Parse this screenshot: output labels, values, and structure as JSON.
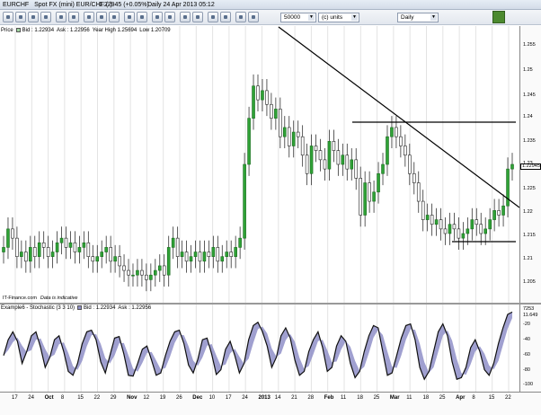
{
  "window": {
    "symbol": "EURCHF",
    "instrument": "Spot FX (mini) EUR/CHF (-)",
    "last_price": "1.22945 (+0.05%)",
    "period_info": "Daily  24 Apr 2013 05:12"
  },
  "toolbar": {
    "quantity_value": "50000",
    "units_value": "(c) units",
    "interval_value": "Daily"
  },
  "price_panel": {
    "legend": {
      "label": "Price",
      "bid": "Bid : 1.22934",
      "ask": "Ask : 1.22956",
      "year_high": "Year High 1.25694",
      "year_low": "Low 1.20709"
    },
    "y_ticks": [
      "1.255",
      "1.25",
      "1.245",
      "1.24",
      "1.235",
      "1.23",
      "1.225",
      "1.22",
      "1.215",
      "1.21",
      "1.205"
    ],
    "current_price_flag": "1.22945",
    "watermark": "IT-Finance.com",
    "watermark_note": "Data is indicative"
  },
  "stochastic_panel": {
    "legend": {
      "label": "Example6 - Stochastic (3 3 10)",
      "bid": "Bid : 1.22934",
      "ask": "Ask : 1.22956"
    },
    "y_ticks": [
      "7253",
      "11.649",
      "-20",
      "-40",
      "-60",
      "-80",
      "-100"
    ]
  },
  "x_axis": {
    "labels": [
      {
        "text": "17",
        "major": false
      },
      {
        "text": "24",
        "major": false
      },
      {
        "text": "Oct",
        "major": true
      },
      {
        "text": "8",
        "major": false
      },
      {
        "text": "15",
        "major": false
      },
      {
        "text": "22",
        "major": false
      },
      {
        "text": "29",
        "major": false
      },
      {
        "text": "Nov",
        "major": true
      },
      {
        "text": "12",
        "major": false
      },
      {
        "text": "19",
        "major": false
      },
      {
        "text": "26",
        "major": false
      },
      {
        "text": "Dec",
        "major": true
      },
      {
        "text": "10",
        "major": false
      },
      {
        "text": "17",
        "major": false
      },
      {
        "text": "24",
        "major": false
      },
      {
        "text": "2013",
        "major": true
      },
      {
        "text": "14",
        "major": false
      },
      {
        "text": "21",
        "major": false
      },
      {
        "text": "28",
        "major": false
      },
      {
        "text": "Feb",
        "major": true
      },
      {
        "text": "11",
        "major": false
      },
      {
        "text": "18",
        "major": false
      },
      {
        "text": "25",
        "major": false
      },
      {
        "text": "Mar",
        "major": true
      },
      {
        "text": "11",
        "major": false
      },
      {
        "text": "18",
        "major": false
      },
      {
        "text": "25",
        "major": false
      },
      {
        "text": "Apr",
        "major": true
      },
      {
        "text": "8",
        "major": false
      },
      {
        "text": "15",
        "major": false
      },
      {
        "text": "22",
        "major": false
      }
    ]
  },
  "colors": {
    "up_candle": "#2fa236",
    "down_candle": "#222222",
    "trendline": "#000000",
    "stoch_fill": "#8f8fc8",
    "stoch_line": "#111111"
  },
  "chart_data": {
    "type": "line",
    "price_range": [
      1.2,
      1.26
    ],
    "stochastic_range": [
      -100,
      0
    ],
    "close": [
      1.212,
      1.216,
      1.214,
      1.21,
      1.211,
      1.209,
      1.212,
      1.21,
      1.213,
      1.212,
      1.21,
      1.211,
      1.213,
      1.214,
      1.212,
      1.213,
      1.211,
      1.212,
      1.213,
      1.21,
      1.209,
      1.21,
      1.211,
      1.212,
      1.209,
      1.21,
      1.208,
      1.207,
      1.206,
      1.206,
      1.207,
      1.206,
      1.205,
      1.206,
      1.207,
      1.208,
      1.206,
      1.212,
      1.214,
      1.21,
      1.211,
      1.209,
      1.21,
      1.211,
      1.209,
      1.211,
      1.21,
      1.212,
      1.209,
      1.21,
      1.211,
      1.21,
      1.212,
      1.214,
      1.23,
      1.24,
      1.247,
      1.244,
      1.246,
      1.243,
      1.24,
      1.242,
      1.236,
      1.238,
      1.234,
      1.237,
      1.236,
      1.232,
      1.228,
      1.234,
      1.233,
      1.231,
      1.229,
      1.235,
      1.233,
      1.23,
      1.232,
      1.229,
      1.231,
      1.227,
      1.219,
      1.226,
      1.222,
      1.224,
      1.228,
      1.23,
      1.236,
      1.238,
      1.236,
      1.234,
      1.232,
      1.228,
      1.226,
      1.222,
      1.218,
      1.219,
      1.217,
      1.218,
      1.216,
      1.215,
      1.217,
      1.216,
      1.214,
      1.215,
      1.216,
      1.218,
      1.217,
      1.215,
      1.216,
      1.218,
      1.22,
      1.219,
      1.221,
      1.229,
      1.23
    ],
    "stochastic": [
      -60,
      -40,
      -30,
      -42,
      -70,
      -55,
      -35,
      -30,
      -50,
      -75,
      -62,
      -40,
      -35,
      -55,
      -80,
      -85,
      -70,
      -45,
      -30,
      -28,
      -40,
      -68,
      -82,
      -60,
      -38,
      -36,
      -58,
      -85,
      -86,
      -70,
      -52,
      -48,
      -66,
      -85,
      -82,
      -60,
      -42,
      -30,
      -28,
      -45,
      -72,
      -82,
      -65,
      -40,
      -38,
      -58,
      -84,
      -78,
      -52,
      -42,
      -60,
      -82,
      -70,
      -40,
      -22,
      -18,
      -30,
      -48,
      -75,
      -62,
      -35,
      -25,
      -38,
      -66,
      -85,
      -80,
      -55,
      -40,
      -30,
      -50,
      -80,
      -75,
      -48,
      -35,
      -42,
      -70,
      -88,
      -80,
      -55,
      -35,
      -22,
      -25,
      -55,
      -85,
      -82,
      -60,
      -38,
      -22,
      -20,
      -40,
      -75,
      -90,
      -80,
      -55,
      -30,
      -20,
      -35,
      -68,
      -90,
      -88,
      -75,
      -50,
      -40,
      -55,
      -78,
      -85,
      -70,
      -45,
      -25,
      -8,
      -5
    ]
  }
}
